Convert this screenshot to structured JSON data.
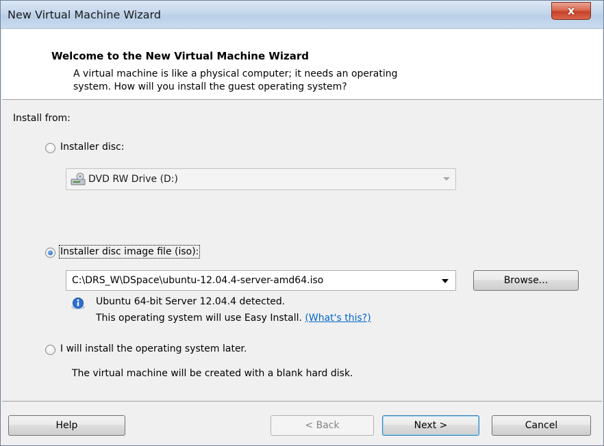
{
  "window": {
    "title": "New Virtual Machine Wizard",
    "close_glyph": "x"
  },
  "header": {
    "title": "Welcome to the New Virtual Machine Wizard",
    "description_line1": "A virtual machine is like a physical computer; it needs an operating",
    "description_line2": "system. How will you install the guest operating system?"
  },
  "install": {
    "section_label": "Install from:",
    "option_disc": {
      "label": "Installer disc:",
      "selected": false
    },
    "disc_combo": {
      "value": "DVD RW Drive (D:)",
      "icon": "dvd-drive-icon"
    },
    "option_iso": {
      "label": "Installer disc image file (iso):",
      "selected": true
    },
    "iso_combo": {
      "value": "C:\\DRS_W\\DSpace\\ubuntu-12.04.4-server-amd64.iso"
    },
    "browse_label": "Browse...",
    "detected_line1": "Ubuntu 64-bit Server 12.04.4 detected.",
    "detected_line2": "This operating system will use Easy Install.",
    "whats_this": "(What's this?)",
    "info_icon": "info-icon",
    "option_later": {
      "label": "I will install the operating system later.",
      "selected": false
    },
    "later_note": "The virtual machine will be created with a blank hard disk."
  },
  "footer": {
    "help": "Help",
    "back": "< Back",
    "next": "Next >",
    "cancel": "Cancel"
  },
  "colors": {
    "accent": "#2a6bc4",
    "link": "#0066cc",
    "close_button": "#c7412a"
  }
}
